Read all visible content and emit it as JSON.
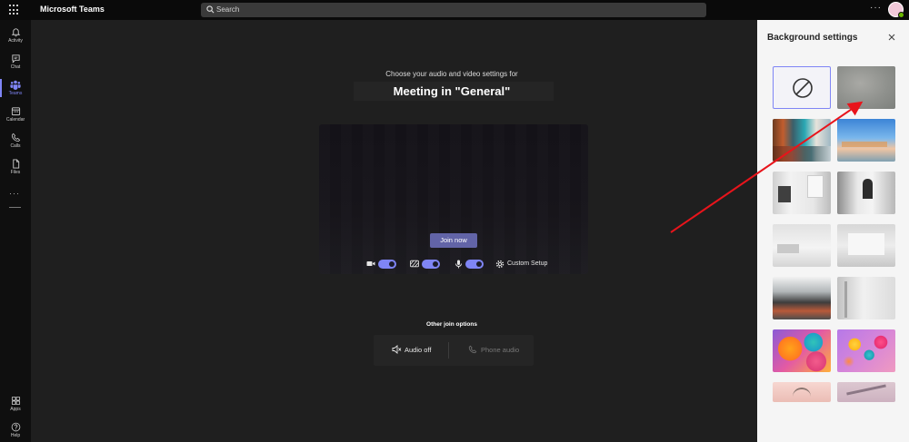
{
  "topbar": {
    "app_name": "Microsoft Teams",
    "search_placeholder": "Search",
    "more_label": "···"
  },
  "rail": {
    "items": [
      {
        "label": "Activity",
        "icon": "bell-icon"
      },
      {
        "label": "Chat",
        "icon": "chat-icon"
      },
      {
        "label": "Teams",
        "icon": "teams-icon",
        "active": true
      },
      {
        "label": "Calendar",
        "icon": "calendar-icon"
      },
      {
        "label": "Calls",
        "icon": "phone-icon"
      },
      {
        "label": "Files",
        "icon": "file-icon"
      }
    ],
    "more_label": "···",
    "bottom_items": [
      {
        "label": "Apps",
        "icon": "apps-icon"
      },
      {
        "label": "Help",
        "icon": "help-icon"
      }
    ]
  },
  "meeting": {
    "subtitle": "Choose your audio and video settings for",
    "title": "Meeting in \"General\"",
    "join_label": "Join now",
    "custom_setup_label": "Custom Setup",
    "camera_on": true,
    "background_effects_on": true,
    "mic_on": true
  },
  "other_options": {
    "title": "Other join options",
    "audio_off_label": "Audio off",
    "phone_audio_label": "Phone audio"
  },
  "panel": {
    "title": "Background settings",
    "close_icon": "close-icon",
    "tiles": [
      {
        "name": "none",
        "selected": true
      },
      {
        "name": "blur"
      },
      {
        "name": "office-colorful"
      },
      {
        "name": "beach-sky"
      },
      {
        "name": "white-room-window"
      },
      {
        "name": "white-room-mirror"
      },
      {
        "name": "white-loft"
      },
      {
        "name": "white-gallery"
      },
      {
        "name": "industrial-office"
      },
      {
        "name": "white-hallway"
      },
      {
        "name": "balloons-orange"
      },
      {
        "name": "balloons-purple"
      },
      {
        "name": "pink-landscape"
      },
      {
        "name": "pink-tower"
      }
    ]
  },
  "colors": {
    "accent": "#6264a7",
    "toggle": "#7f85f5",
    "annotation_arrow": "#e8141b"
  }
}
